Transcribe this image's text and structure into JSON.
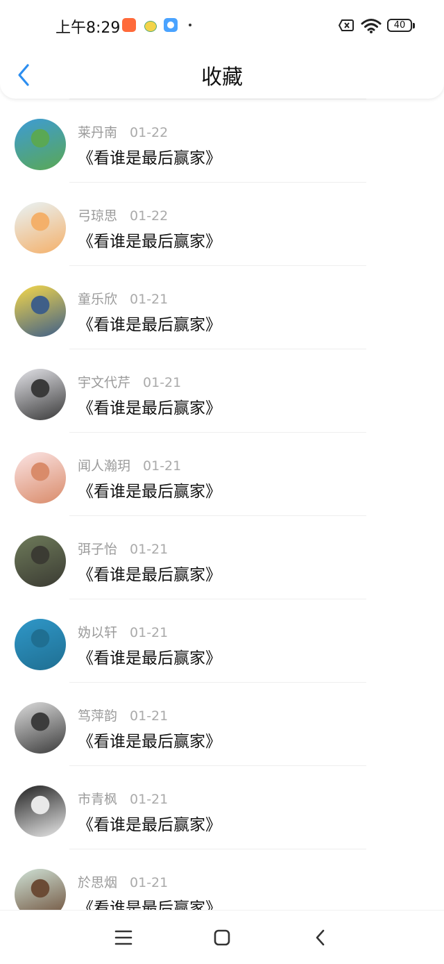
{
  "status_bar": {
    "time": "上午8:29",
    "battery": "40",
    "icons": [
      "shop-app-icon",
      "chat-app-icon",
      "browser-app-icon",
      "notification-dot-icon",
      "no-sim-icon",
      "wifi-icon",
      "battery-icon"
    ]
  },
  "header": {
    "title": "收藏",
    "back_icon": "chevron-left-icon",
    "accent": "#2c8ef0"
  },
  "items": [
    {
      "name": "莱丹南",
      "date": "01-22",
      "title": "《看谁是最后赢家》",
      "avatar": [
        "#3d9bd6",
        "#5aa854"
      ]
    },
    {
      "name": "弓琼思",
      "date": "01-22",
      "title": "《看谁是最后赢家》",
      "avatar": [
        "#e8f3f6",
        "#f4b06a"
      ]
    },
    {
      "name": "童乐欣",
      "date": "01-21",
      "title": "《看谁是最后赢家》",
      "avatar": [
        "#f5d84a",
        "#3f5f88"
      ]
    },
    {
      "name": "宇文代芹",
      "date": "01-21",
      "title": "《看谁是最后赢家》",
      "avatar": [
        "#e3e3e8",
        "#3a3a3a"
      ]
    },
    {
      "name": "闻人瀚玥",
      "date": "01-21",
      "title": "《看谁是最后赢家》",
      "avatar": [
        "#fbe4e4",
        "#d98b6a"
      ]
    },
    {
      "name": "弭子怡",
      "date": "01-21",
      "title": "《看谁是最后赢家》",
      "avatar": [
        "#6e7b5a",
        "#3b3b33"
      ]
    },
    {
      "name": "妫以轩",
      "date": "01-21",
      "title": "《看谁是最后赢家》",
      "avatar": [
        "#2f97c8",
        "#1f6f92"
      ]
    },
    {
      "name": "笃萍韵",
      "date": "01-21",
      "title": "《看谁是最后赢家》",
      "avatar": [
        "#dcdcdc",
        "#3c3c3c"
      ]
    },
    {
      "name": "市青枫",
      "date": "01-21",
      "title": "《看谁是最后赢家》",
      "avatar": [
        "#202020",
        "#e8e8e8"
      ]
    },
    {
      "name": "於思烟",
      "date": "01-21",
      "title": "《看谁是最后赢家》",
      "avatar": [
        "#cfe2d6",
        "#6b4b35"
      ]
    }
  ],
  "nav_bar": {
    "icons": [
      "menu-icon",
      "home-square-icon",
      "back-triangle-icon"
    ]
  }
}
